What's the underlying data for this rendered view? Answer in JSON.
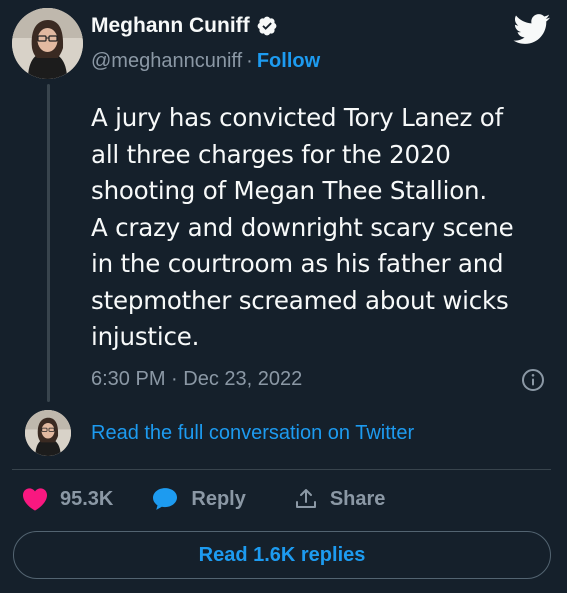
{
  "author": {
    "name": "Meghann Cuniff",
    "handle": "@meghanncuniff",
    "separator": "·",
    "follow_label": "Follow"
  },
  "tweet": {
    "lines": [
      "A jury has convicted Tory Lanez of",
      "all three charges for the 2020",
      "shooting of Megan Thee Stallion.",
      "A crazy and downright scary scene",
      "in the courtroom as his father and",
      "stepmother screamed about wicks",
      "injustice."
    ],
    "timestamp": "6:30 PM · Dec 23, 2022"
  },
  "conversation_link": "Read the full conversation on Twitter",
  "actions": {
    "likes": "95.3K",
    "reply": "Reply",
    "share": "Share"
  },
  "read_replies": "Read 1.6K replies",
  "icons": {
    "verified": "verified-badge-icon",
    "brand": "twitter-bird-icon",
    "info": "info-icon",
    "like": "heart-icon",
    "reply": "speech-bubble-icon",
    "share": "share-upload-icon"
  },
  "colors": {
    "background": "#15202b",
    "accent": "#1d9bf0",
    "like": "#f91880",
    "muted": "#8b98a5",
    "text": "#f7f9f9",
    "border": "#38444d"
  }
}
